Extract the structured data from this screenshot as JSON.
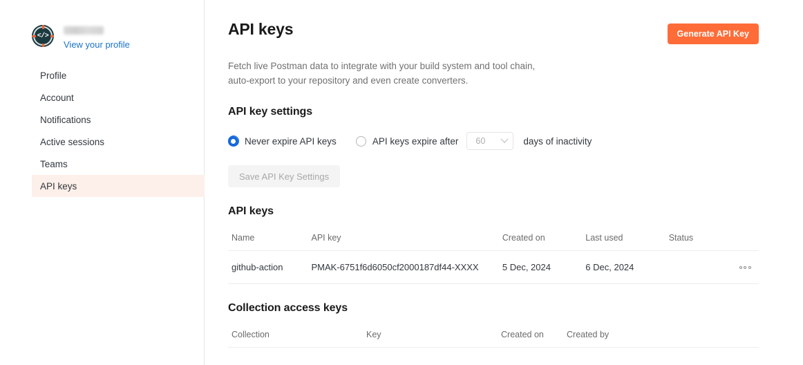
{
  "sidebar": {
    "profile": {
      "avatar_icon": "code-avatar-icon",
      "username_redacted": true,
      "profile_link_label": "View your profile"
    },
    "items": [
      {
        "label": "Profile",
        "active": false
      },
      {
        "label": "Account",
        "active": false
      },
      {
        "label": "Notifications",
        "active": false
      },
      {
        "label": "Active sessions",
        "active": false
      },
      {
        "label": "Teams",
        "active": false
      },
      {
        "label": "API keys",
        "active": true
      }
    ]
  },
  "main": {
    "page_title": "API keys",
    "generate_button_label": "Generate API Key",
    "description_line1": "Fetch live Postman data to integrate with your build system and tool chain,",
    "description_line2": "auto-export to your repository and even create converters.",
    "settings": {
      "section_title": "API key settings",
      "option_never_expire": "Never expire API keys",
      "option_expire_after": "API keys expire after",
      "expiry_days_value": "60",
      "expiry_suffix": "days of inactivity",
      "selected_option": "never_expire",
      "save_button_label": "Save API Key Settings",
      "save_button_disabled": true
    },
    "api_keys_table": {
      "section_title": "API keys",
      "columns": [
        "Name",
        "API key",
        "Created on",
        "Last used",
        "Status"
      ],
      "rows": [
        {
          "name": "github-action",
          "api_key": "PMAK-6751f6d6050cf2000187df44-XXXX",
          "created_on": "5 Dec, 2024",
          "last_used": "6 Dec, 2024",
          "status_enabled": true,
          "menu_icon": "more-horizontal-icon"
        }
      ]
    },
    "collection_access_keys_table": {
      "section_title": "Collection access keys",
      "columns": [
        "Collection",
        "Key",
        "Created on",
        "Created by"
      ],
      "rows": []
    }
  },
  "colors": {
    "brand_orange": "#ff6c37",
    "active_nav_bg": "#fdefe9",
    "link_blue": "#1a73c7",
    "toggle_blue": "#1668dc",
    "radio_blue": "#1668dc"
  }
}
